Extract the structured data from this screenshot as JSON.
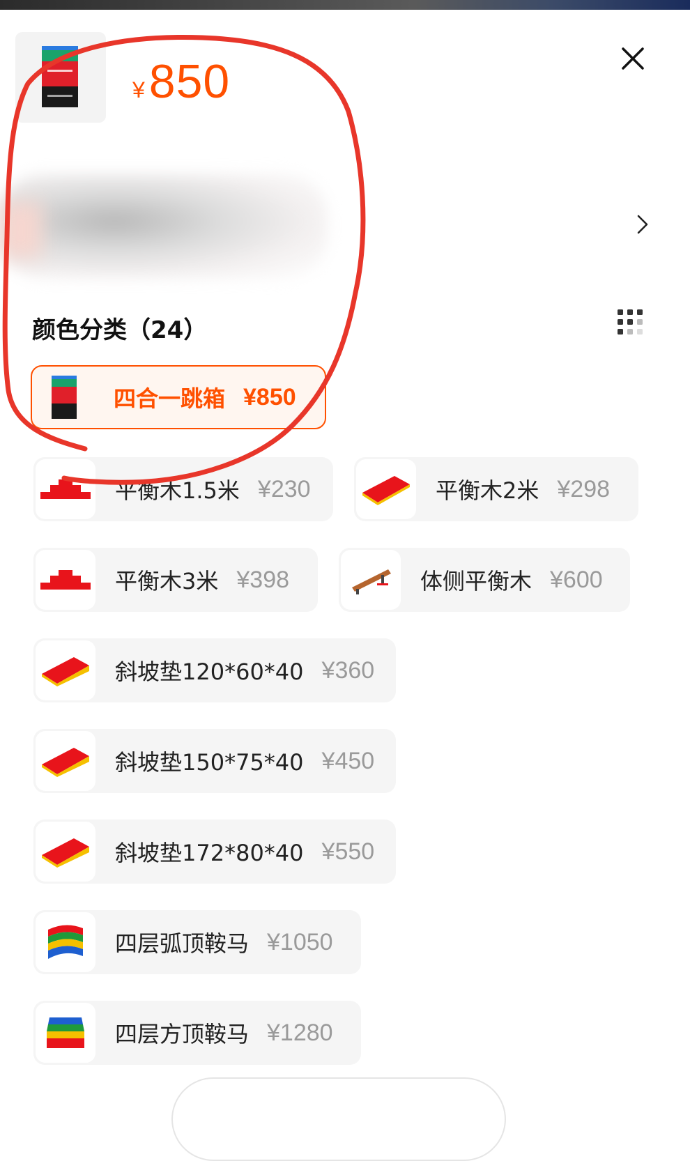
{
  "header": {
    "currency": "¥",
    "price": "850"
  },
  "section": {
    "title": "颜色分类（24）"
  },
  "colors": {
    "accent": "#ff5000",
    "price_gray": "#9a9a9a",
    "annotation": "#e8362a"
  },
  "options": [
    {
      "name": "四合一跳箱",
      "price": "¥850",
      "selected": true,
      "icon": "jump-box-icon"
    },
    {
      "name": "平衡木1.5米",
      "price": "¥230",
      "selected": false,
      "icon": "balance-beam-icon"
    },
    {
      "name": "平衡木2米",
      "price": "¥298",
      "selected": false,
      "icon": "balance-beam-mat-icon"
    },
    {
      "name": "平衡木3米",
      "price": "¥398",
      "selected": false,
      "icon": "balance-beam-icon"
    },
    {
      "name": "体侧平衡木",
      "price": "¥600",
      "selected": false,
      "icon": "wooden-beam-icon"
    },
    {
      "name": "斜坡垫120*60*40",
      "price": "¥360",
      "selected": false,
      "icon": "incline-mat-icon"
    },
    {
      "name": "斜坡垫150*75*40",
      "price": "¥450",
      "selected": false,
      "icon": "incline-mat-icon"
    },
    {
      "name": "斜坡垫172*80*40",
      "price": "¥550",
      "selected": false,
      "icon": "incline-mat-icon"
    },
    {
      "name": "四层弧顶鞍马",
      "price": "¥1050",
      "selected": false,
      "icon": "vaulting-horse-icon"
    },
    {
      "name": "四层方顶鞍马",
      "price": "¥1280",
      "selected": false,
      "icon": "vaulting-horse-icon"
    }
  ]
}
